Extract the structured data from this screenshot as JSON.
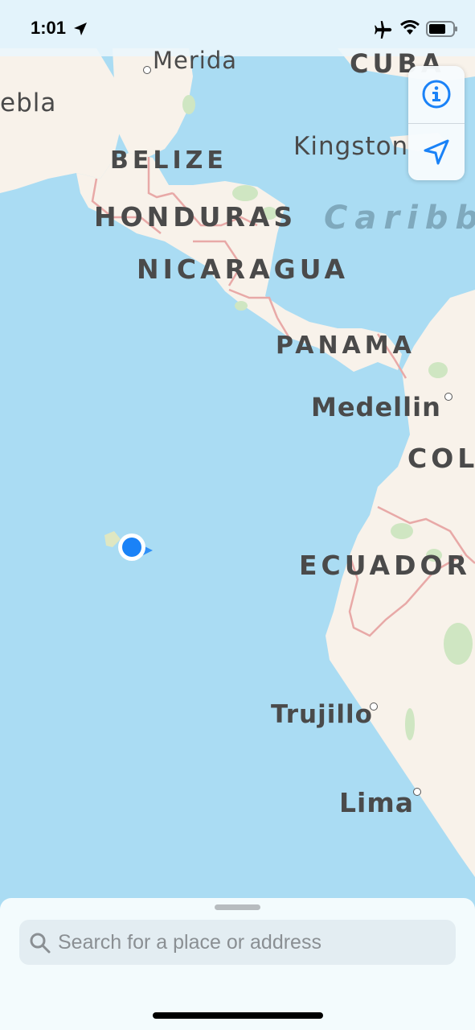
{
  "status_bar": {
    "time": "1:01"
  },
  "map": {
    "countries": [
      "CUBA",
      "BELIZE",
      "HONDURAS",
      "NICARAGUA",
      "PANAMA",
      "COL",
      "ECUADOR"
    ],
    "sea": "Caribb",
    "cities": [
      "Merida",
      "ebla",
      "Kingston",
      "Medellin",
      "Trujillo",
      "Lima"
    ]
  },
  "controls": {
    "info_icon": "info-icon",
    "location_icon": "location-arrow-icon"
  },
  "search": {
    "placeholder": "Search for a place or address"
  },
  "colors": {
    "water": "#aadcf3",
    "land": "#f8f2ea",
    "border": "#e8a9a7",
    "accent": "#1a82f7"
  }
}
